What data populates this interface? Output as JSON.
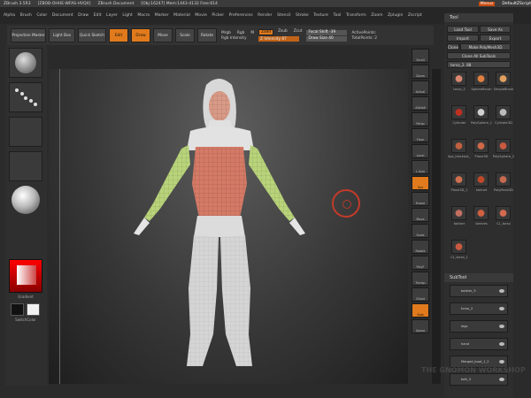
{
  "titlebar": {
    "app": "ZBrush 3.5R3",
    "doc_name": "[ZBOB-OHHE-WFAS-HVQX]",
    "doc": "ZBrush Document",
    "stats": "[Obj:16247]  Mem:1443-4132  Free:614",
    "menu_btn": "Menus",
    "script": "DefaultZScript"
  },
  "menu": [
    "Alpha",
    "Brush",
    "Color",
    "Document",
    "Draw",
    "Edit",
    "Layer",
    "Light",
    "Macro",
    "Marker",
    "Material",
    "Movie",
    "Picker",
    "Preferences",
    "Render",
    "Stencil",
    "Stroke",
    "Texture",
    "Tool",
    "Transform",
    "Zoom",
    "Zplugin",
    "Zscript"
  ],
  "shelf": {
    "projection_master": "Projection Master",
    "lightbox": "Light Box",
    "quick_sketch": "Quick Sketch",
    "edit": "Edit",
    "draw": "Draw",
    "move": "Move",
    "scale": "Scale",
    "rotate": "Rotate",
    "mrgb": "Mrgb",
    "rgb": "Rgb",
    "m": "M",
    "rgb_intensity": "Rgb Intensity",
    "zadd": "Zadd",
    "zsub": "Zsub",
    "zcut": "Zcut",
    "z_intensity": "Z Intensity 87",
    "focal_shift": "Focal Shift -39",
    "draw_size": "Draw Size 40",
    "active_points": "ActivePoints:",
    "total_points": "TotalPoints: 2"
  },
  "left_tiles": {
    "gradient": "Gradient",
    "switch_color": "SwitchColor"
  },
  "right_shelf": [
    "Scroll",
    "Zoom",
    "Actual",
    "AAHalf",
    "Persp",
    "Floor",
    "Local",
    "L.Sym",
    "Xyz",
    "Frame",
    "Move",
    "Scale",
    "Rotate",
    "PolyF",
    "Transp",
    "Ghost",
    "Solo",
    "Xpose"
  ],
  "tool_panel": {
    "title": "Tool",
    "load_tool": "Load Tool",
    "save_as": "Save As",
    "import": "Import",
    "export": "Export",
    "clone": "Clone",
    "make_polymesh": "Make PolyMesh3D",
    "clone_all": "Clone All SubTools",
    "current_tool": "torso_2. 88",
    "thumbs": [
      "torso_2",
      "SphereBrush",
      "SimpleBrush",
      "Cylinder",
      "PolySphere_1",
      "Cylinder3D",
      "Aya_blockout_13",
      "Plane3D",
      "PolySphere_2",
      "Plane3D_1",
      "helmet",
      "PolyMesh3D",
      "bolster",
      "sleeves",
      "CL_torso",
      "CL_torso_1"
    ]
  },
  "subtool": {
    "title": "SubTool",
    "items": [
      "bolster_3",
      "torso_2",
      "legs",
      "hand",
      "Merged_boot_1_2",
      "belt_3"
    ]
  },
  "watermark": "THE GNOMON WORKSHOP"
}
